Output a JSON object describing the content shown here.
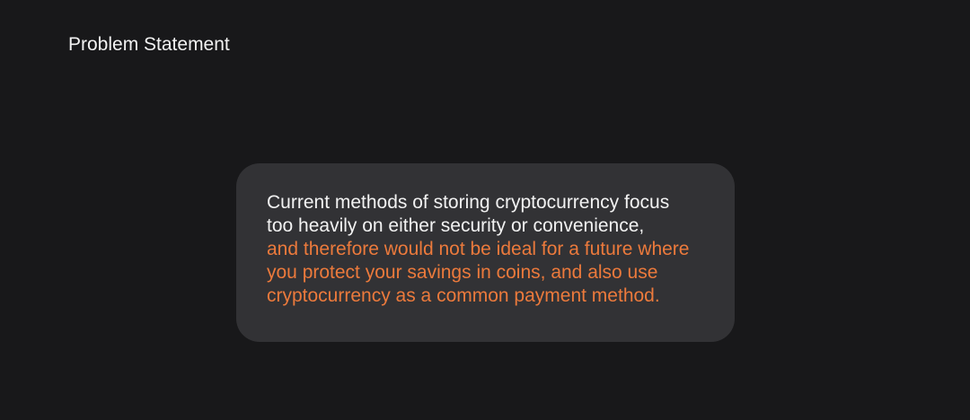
{
  "header": {
    "title": "Problem Statement"
  },
  "statement": {
    "lines": [
      {
        "text": "Current methods of storing cryptocurrency focus",
        "emphasis": false
      },
      {
        "text": "too heavily on either security or convenience,",
        "emphasis": false
      },
      {
        "text": "and therefore would not be ideal for a future where",
        "emphasis": true
      },
      {
        "text": "you protect your savings in coins, and also use",
        "emphasis": true
      },
      {
        "text": "cryptocurrency as a common payment method.",
        "emphasis": true
      }
    ]
  },
  "colors": {
    "background": "#18181a",
    "card": "#323235",
    "text": "#f2f2f2",
    "highlight": "#ec7a3c"
  }
}
